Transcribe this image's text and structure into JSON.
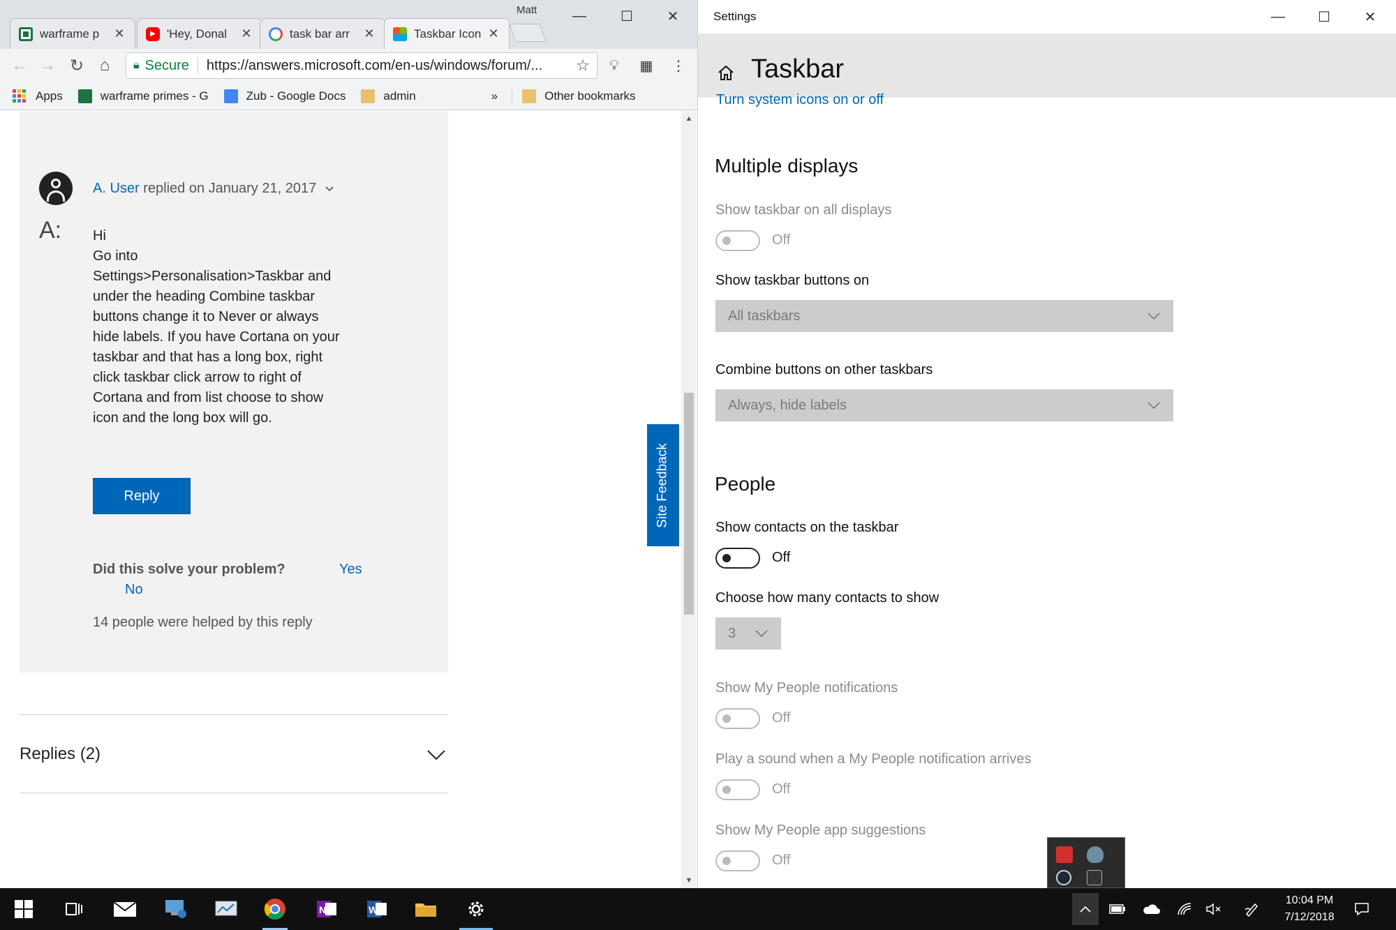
{
  "chrome": {
    "profile_name": "Matt",
    "tabs": [
      {
        "title": "warframe p",
        "favicon_color": "#1a7340"
      },
      {
        "title": "'Hey, Donal",
        "favicon_color": "#ff0000"
      },
      {
        "title": "task bar arr",
        "favicon_color": "#4285f4"
      },
      {
        "title": "Taskbar Icon",
        "favicon_color": "#f25022"
      }
    ],
    "omnibox": {
      "secure_label": "Secure",
      "url": "https://answers.microsoft.com/en-us/windows/forum/..."
    },
    "bookmarks": [
      {
        "label": "Apps"
      },
      {
        "label": "warframe primes - G"
      },
      {
        "label": "Zub - Google Docs"
      },
      {
        "label": "admin"
      }
    ],
    "bookmarks_overflow": "»",
    "other_bookmarks": "Other bookmarks"
  },
  "answer": {
    "author": "A. User",
    "replied_on": " replied on January 21, 2017",
    "prefix": "A:",
    "lines": [
      "Hi",
      "Go into",
      "Settings>Personalisation>Taskbar and",
      "under the heading Combine taskbar",
      "buttons change it to Never or always",
      "hide labels. If you have Cortana on your",
      "taskbar and that has a long box, right",
      "click taskbar click arrow to right of",
      "Cortana and from list choose to show",
      "icon and the long box will go."
    ],
    "reply_button": "Reply",
    "solve_question": "Did this solve your problem?",
    "yes": "Yes",
    "no": "No",
    "helped": "14 people were helped by this reply"
  },
  "replies_label": "Replies (2)",
  "site_feedback": "Site Feedback",
  "settings": {
    "window_title": "Settings",
    "page_title": "Taskbar",
    "system_icons_link": "Turn system icons on or off",
    "multiple_displays": {
      "heading": "Multiple displays",
      "show_all_label": "Show taskbar on all displays",
      "show_all_state": "Off",
      "buttons_on_label": "Show taskbar buttons on",
      "buttons_on_value": "All taskbars",
      "combine_label": "Combine buttons on other taskbars",
      "combine_value": "Always, hide labels"
    },
    "people": {
      "heading": "People",
      "show_contacts_label": "Show contacts on the taskbar",
      "show_contacts_state": "Off",
      "how_many_label": "Choose how many contacts to show",
      "how_many_value": "3",
      "notifications_label": "Show My People notifications",
      "notifications_state": "Off",
      "sound_label": "Play a sound when a My People notification arrives",
      "sound_state": "Off",
      "suggestions_label": "Show My People app suggestions",
      "suggestions_state": "Off"
    }
  },
  "taskbar": {
    "time": "10:04 PM",
    "date": "7/12/2018",
    "accent": "#76b9ed"
  }
}
